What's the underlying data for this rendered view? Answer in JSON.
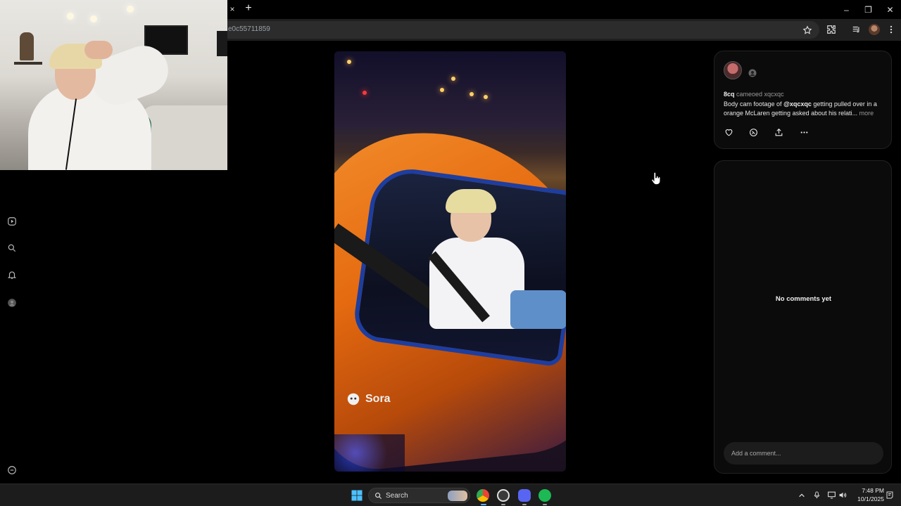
{
  "browser": {
    "tab_close": "×",
    "new_tab": "+",
    "url": "e0c55711859",
    "window_controls": {
      "minimize": "–",
      "maximize": "❐",
      "close": "✕"
    }
  },
  "post": {
    "author": "8cq",
    "action": "cameoed xqcxqc",
    "caption_before": "Body cam footage of ",
    "mention": "@xqcxqc",
    "caption_after": " getting pulled over in a orange McLaren getting asked about his relati...",
    "more": "more"
  },
  "video": {
    "watermark": "Sora"
  },
  "comments": {
    "empty_text": "No comments yet",
    "input_placeholder": "Add a comment..."
  },
  "taskbar": {
    "search_label": "Search",
    "time": "7:48 PM",
    "date": "10/1/2025"
  },
  "colors": {
    "background": "#000000",
    "panel": "#0b0b0b",
    "accent_orange": "#e56a10"
  }
}
